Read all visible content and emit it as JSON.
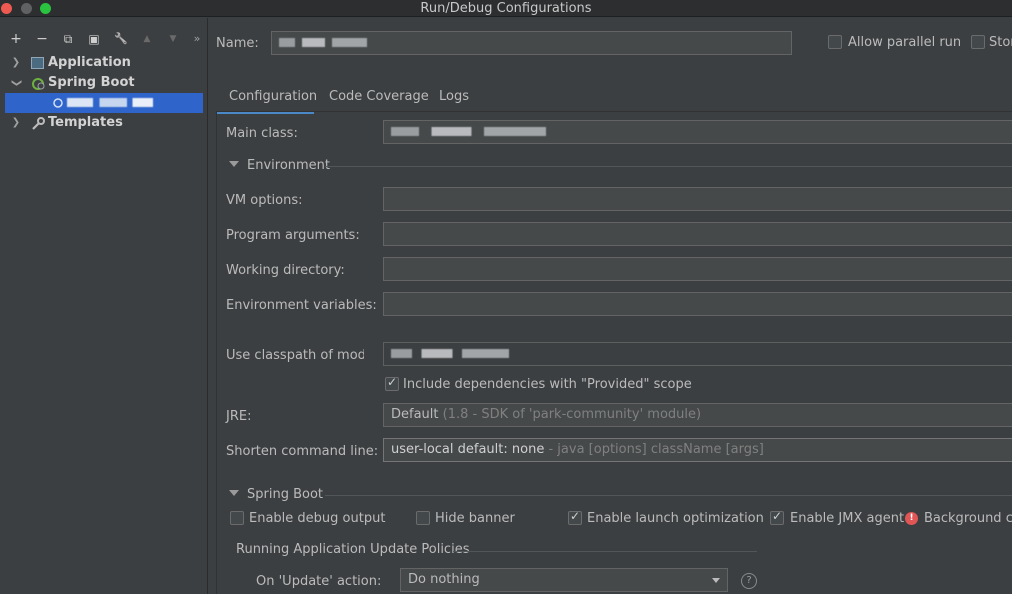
{
  "window": {
    "title": "Run/Debug Configurations"
  },
  "toolbar": {
    "add": "+",
    "remove": "−",
    "copy": "⧉",
    "save": "▣",
    "edit": "🔧",
    "up": "▲",
    "down": "▼",
    "more": "»"
  },
  "tree": {
    "items": [
      {
        "label": "Application"
      },
      {
        "label": "Spring Boot"
      },
      {
        "label": ""
      },
      {
        "label": "Templates"
      }
    ]
  },
  "header": {
    "name_label": "Name:",
    "name_value": "",
    "allow_parallel_label": "Allow parallel run",
    "store_label": "Stor"
  },
  "tabs": [
    {
      "label": "Configuration"
    },
    {
      "label": "Code Coverage"
    },
    {
      "label": "Logs"
    }
  ],
  "config": {
    "main_class_label": "Main class:",
    "main_class_value": "",
    "environment_section": "Environment",
    "vm_options_label": "VM options:",
    "program_args_label": "Program arguments:",
    "working_dir_label": "Working directory:",
    "env_vars_label": "Environment variables:",
    "classpath_label": "Use classpath of module",
    "classpath_value": "",
    "include_provided_label": "Include dependencies with \"Provided\" scope",
    "include_provided_checked": true,
    "jre_label": "JRE:",
    "jre_value": "Default",
    "jre_hint": "(1.8 - SDK of 'park-community' module)",
    "shorten_label": "Shorten command line:",
    "shorten_value": "user-local default: none",
    "shorten_hint": "- java [options] className [args]"
  },
  "spring_boot": {
    "section": "Spring Boot",
    "enable_debug_label": "Enable debug output",
    "enable_debug_checked": false,
    "hide_banner_label": "Hide banner",
    "hide_banner_checked": false,
    "launch_opt_label": "Enable launch optimization",
    "launch_opt_checked": true,
    "jmx_label": "Enable JMX agent",
    "jmx_checked": true,
    "background_label": "Background co",
    "policies_title": "Running Application Update Policies",
    "on_update_label": "On 'Update' action:",
    "on_update_value": "Do nothing",
    "help": "?"
  },
  "colors": {
    "accent": "#2f65ca",
    "tab_underline": "#4a88c7",
    "background": "#3c3f41",
    "error": "#e05555"
  }
}
